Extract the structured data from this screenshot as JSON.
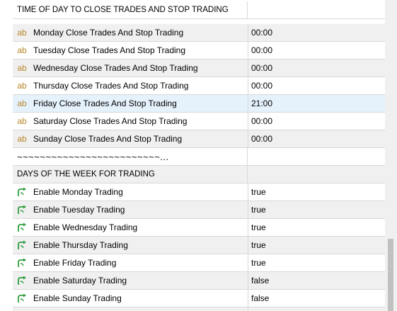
{
  "section_time": {
    "header": "TIME OF DAY TO CLOSE TRADES AND STOP TRADING",
    "rows": [
      {
        "icon": "ab",
        "label": "Monday Close Trades And Stop Trading",
        "value": "00:00"
      },
      {
        "icon": "ab",
        "label": "Tuesday Close Trades And Stop Trading",
        "value": "00:00"
      },
      {
        "icon": "ab",
        "label": "Wednesday Close Trades And Stop Trading",
        "value": "00:00"
      },
      {
        "icon": "ab",
        "label": "Thursday Close Trades And Stop Trading",
        "value": "00:00"
      },
      {
        "icon": "ab",
        "label": "Friday Close Trades And Stop Trading",
        "value": "21:00"
      },
      {
        "icon": "ab",
        "label": "Saturday Close Trades And Stop Trading",
        "value": "00:00"
      },
      {
        "icon": "ab",
        "label": "Sunday Close Trades And Stop Trading",
        "value": "00:00"
      }
    ]
  },
  "separator": "~~~~~~~~~~~~~~~~~~~~~~~~~...",
  "section_days": {
    "header": "DAYS OF THE WEEK FOR TRADING",
    "rows": [
      {
        "label": "Enable Monday Trading",
        "value": "true"
      },
      {
        "label": "Enable Tuesday Trading",
        "value": "true"
      },
      {
        "label": "Enable Wednesday Trading",
        "value": "true"
      },
      {
        "label": "Enable Thursday Trading",
        "value": "true"
      },
      {
        "label": "Enable Friday Trading",
        "value": "true"
      },
      {
        "label": "Enable Saturday Trading",
        "value": "false"
      },
      {
        "label": "Enable Sunday Trading",
        "value": "false"
      }
    ]
  },
  "colors": {
    "ab_icon": "#b8862b",
    "bool_icon": "#2e9e3e",
    "selected_row": "#e5f1fb"
  }
}
